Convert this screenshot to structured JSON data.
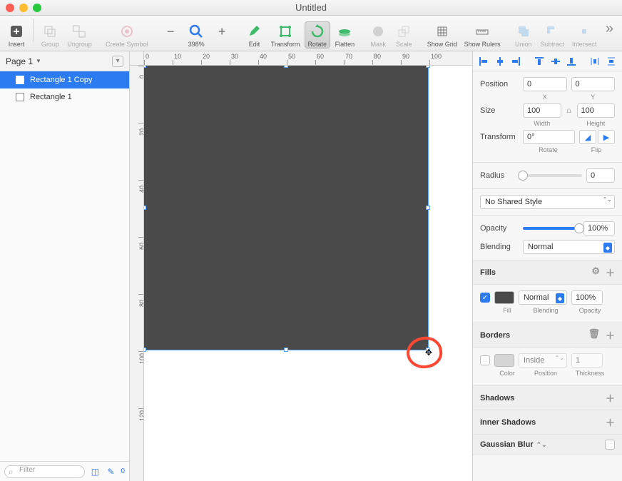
{
  "window": {
    "title": "Untitled"
  },
  "toolbar": {
    "insert": "Insert",
    "group": "Group",
    "ungroup": "Ungroup",
    "create_symbol": "Create Symbol",
    "zoom_pct": "398%",
    "edit": "Edit",
    "transform": "Transform",
    "rotate": "Rotate",
    "flatten": "Flatten",
    "mask": "Mask",
    "scale": "Scale",
    "show_grid": "Show Grid",
    "show_rulers": "Show Rulers",
    "union": "Union",
    "subtract": "Subtract",
    "intersect": "Intersect"
  },
  "sidebar": {
    "page_label": "Page 1",
    "layers": [
      {
        "name": "Rectangle 1 Copy",
        "selected": true
      },
      {
        "name": "Rectangle 1",
        "selected": false
      }
    ],
    "filter_placeholder": "Filter",
    "layer_count": "0"
  },
  "ruler": {
    "h": [
      "0",
      "10",
      "20",
      "30",
      "40",
      "50",
      "60",
      "70",
      "80",
      "90",
      "100"
    ],
    "v": [
      "0",
      "20",
      "40",
      "60",
      "80",
      "100",
      "120"
    ]
  },
  "inspector": {
    "position_label": "Position",
    "pos_x": "0",
    "pos_y": "0",
    "x_label": "X",
    "y_label": "Y",
    "size_label": "Size",
    "width": "100",
    "height": "100",
    "w_label": "Width",
    "h_label": "Height",
    "transform_label": "Transform",
    "rotate": "0°",
    "rotate_label": "Rotate",
    "flip_label": "Flip",
    "radius_label": "Radius",
    "radius": "0",
    "shared_style": "No Shared Style",
    "opacity_label": "Opacity",
    "opacity": "100%",
    "blending_label": "Blending",
    "blending": "Normal",
    "fills_label": "Fills",
    "fill_sub": "Fill",
    "fill_blend_sub": "Blending",
    "fill_op_sub": "Opacity",
    "fill_blend": "Normal",
    "fill_opacity": "100%",
    "borders_label": "Borders",
    "border_color_sub": "Color",
    "border_pos_sub": "Position",
    "border_thick_sub": "Thickness",
    "border_pos": "Inside",
    "border_thick": "1",
    "shadows_label": "Shadows",
    "inner_shadows_label": "Inner Shadows",
    "blur_label": "Gaussian Blur"
  },
  "colors": {
    "shape_fill": "#4a4a4a",
    "border_chip": "#d5d5d5"
  }
}
